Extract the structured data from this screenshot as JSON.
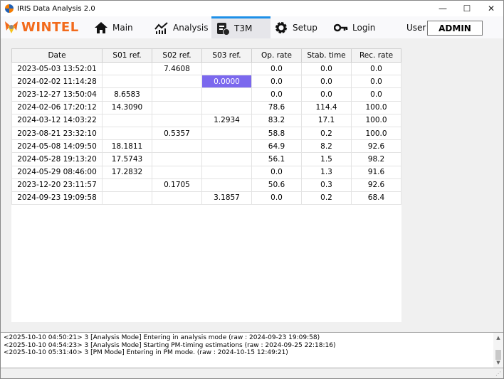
{
  "window": {
    "title": "IRIS Data Analysis 2.0",
    "minimize": "—",
    "maximize": "☐",
    "close": "✕"
  },
  "nav": {
    "logo": "WINTEL",
    "tabs": [
      {
        "label": "Main",
        "icon": "home-icon"
      },
      {
        "label": "Analysis",
        "icon": "chart-icon"
      },
      {
        "label": "T3M",
        "icon": "schedule-icon"
      },
      {
        "label": "Setup",
        "icon": "gear-icon"
      },
      {
        "label": "Login",
        "icon": "key-icon"
      }
    ],
    "active_tab": "T3M",
    "user_label": "User",
    "user_value": "ADMIN"
  },
  "table": {
    "headers": [
      "Date",
      "S01 ref.",
      "S02 ref.",
      "S03 ref.",
      "Op. rate",
      "Stab. time",
      "Rec. rate"
    ],
    "rows": [
      [
        "2023-05-03 13:52:01",
        "",
        "7.4608",
        "",
        "0.0",
        "0.0",
        "0.0"
      ],
      [
        "2024-02-02 11:14:28",
        "",
        "",
        "0.0000",
        "0.0",
        "0.0",
        "0.0"
      ],
      [
        "2023-12-27 13:50:04",
        "8.6583",
        "",
        "",
        "0.0",
        "0.0",
        "0.0"
      ],
      [
        "2024-02-06 17:20:12",
        "14.3090",
        "",
        "",
        "78.6",
        "114.4",
        "100.0"
      ],
      [
        "2024-03-12 14:03:22",
        "",
        "",
        "1.2934",
        "83.2",
        "17.1",
        "100.0"
      ],
      [
        "2023-08-21 23:32:10",
        "",
        "0.5357",
        "",
        "58.8",
        "0.2",
        "100.0"
      ],
      [
        "2024-05-08 14:09:50",
        "18.1811",
        "",
        "",
        "64.9",
        "8.2",
        "92.6"
      ],
      [
        "2024-05-28 19:13:20",
        "17.5743",
        "",
        "",
        "56.1",
        "1.5",
        "98.2"
      ],
      [
        "2024-05-29 08:46:00",
        "17.2832",
        "",
        "",
        "0.0",
        "1.3",
        "91.6"
      ],
      [
        "2023-12-20 23:11:57",
        "",
        "0.1705",
        "",
        "50.6",
        "0.3",
        "92.6"
      ],
      [
        "2024-09-23 19:09:58",
        "",
        "",
        "3.1857",
        "0.0",
        "0.2",
        "68.4"
      ]
    ],
    "highlight_color": "#7b68ee"
  },
  "log": [
    "<2025-10-10 04:50:21> 3  [Analysis Mode] Entering in analysis mode (raw : 2024-09-23 19:09:58)",
    "<2025-10-10 04:54:23> 3  [Analysis Mode] Starting PM-timing estimations (raw : 2024-09-25 22:18:16)",
    "<2025-10-10 05:31:40> 3  [PM Mode] Entering in PM mode. (raw : 2024-10-15 12:49:21)"
  ]
}
